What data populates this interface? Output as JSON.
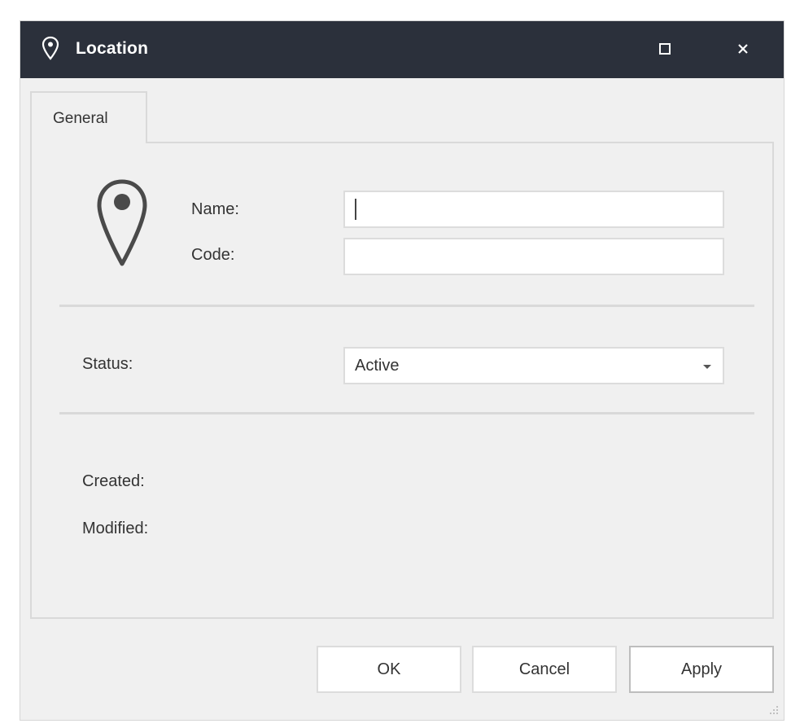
{
  "window": {
    "title": "Location",
    "icon": "map-pin-icon",
    "controls": {
      "maximize_icon": "maximize-icon",
      "close_icon": "close-icon"
    }
  },
  "tabs": [
    {
      "label": "General",
      "active": true
    }
  ],
  "form": {
    "icon": "map-pin-icon",
    "name": {
      "label": "Name:",
      "value": ""
    },
    "code": {
      "label": "Code:",
      "value": ""
    },
    "status": {
      "label": "Status:",
      "value": "Active"
    },
    "created": {
      "label": "Created:"
    },
    "modified": {
      "label": "Modified:"
    }
  },
  "buttons": {
    "ok": "OK",
    "cancel": "Cancel",
    "apply": "Apply"
  },
  "colors": {
    "titlebar": "#2b303b",
    "background": "#f0f0f0",
    "border": "#d9d9d9"
  }
}
